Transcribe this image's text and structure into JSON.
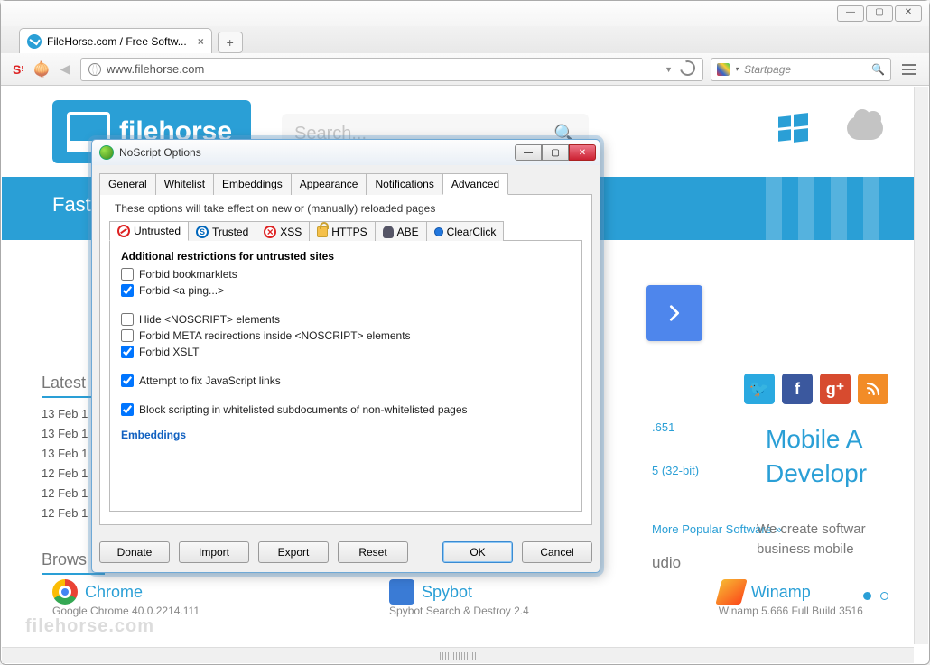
{
  "browser": {
    "tab_title": "FileHorse.com / Free Softw...",
    "url": "www.filehorse.com",
    "search_placeholder": "Startpage"
  },
  "page": {
    "logo_text": "filehorse",
    "hero_prefix": "Fast",
    "search_ghost": "Search...",
    "latest_heading": "Latest",
    "browse_heading": "Brows",
    "dates": [
      "13 Feb 1",
      "13 Feb 1",
      "13 Feb 1",
      "12 Feb 1",
      "12 Feb 1",
      "12 Feb 1"
    ],
    "right_link_1": ".651",
    "right_link_2": "5 (32-bit)",
    "right_col_label": "udio",
    "more_popular": "More Popular Software »",
    "promo_line1": "Mobile A",
    "promo_line2": "Developr",
    "promo_sub1": "We create softwar",
    "promo_sub2": "business mobile",
    "apps": {
      "chrome": {
        "name": "Chrome",
        "sub": "Google Chrome 40.0.2214.111"
      },
      "spybot": {
        "name": "Spybot",
        "sub": "Spybot Search & Destroy 2.4"
      },
      "winamp": {
        "name": "Winamp",
        "sub": "Winamp 5.666 Full Build 3516"
      }
    },
    "watermark": "filehorse.com"
  },
  "dialog": {
    "title": "NoScript Options",
    "tabs": [
      "General",
      "Whitelist",
      "Embeddings",
      "Appearance",
      "Notifications",
      "Advanced"
    ],
    "active_tab": "Advanced",
    "hint": "These options will take effect on new or (manually) reloaded pages",
    "subtabs": [
      "Untrusted",
      "Trusted",
      "XSS",
      "HTTPS",
      "ABE",
      "ClearClick"
    ],
    "active_subtab": "Untrusted",
    "group_title": "Additional restrictions for untrusted sites",
    "checks": [
      {
        "label": "Forbid bookmarklets",
        "checked": false
      },
      {
        "label": "Forbid <a ping...>",
        "checked": true
      },
      {
        "label": "Hide <NOSCRIPT> elements",
        "checked": false,
        "gap_before": true
      },
      {
        "label": "Forbid META redirections inside <NOSCRIPT> elements",
        "checked": false
      },
      {
        "label": "Forbid XSLT",
        "checked": true
      },
      {
        "label": "Attempt to fix JavaScript links",
        "checked": true,
        "gap_before": true
      },
      {
        "label": "Block scripting in whitelisted subdocuments of non-whitelisted pages",
        "checked": true,
        "gap_before": true
      }
    ],
    "embeddings_link": "Embeddings",
    "buttons": {
      "donate": "Donate",
      "import": "Import",
      "export": "Export",
      "reset": "Reset",
      "ok": "OK",
      "cancel": "Cancel"
    }
  }
}
